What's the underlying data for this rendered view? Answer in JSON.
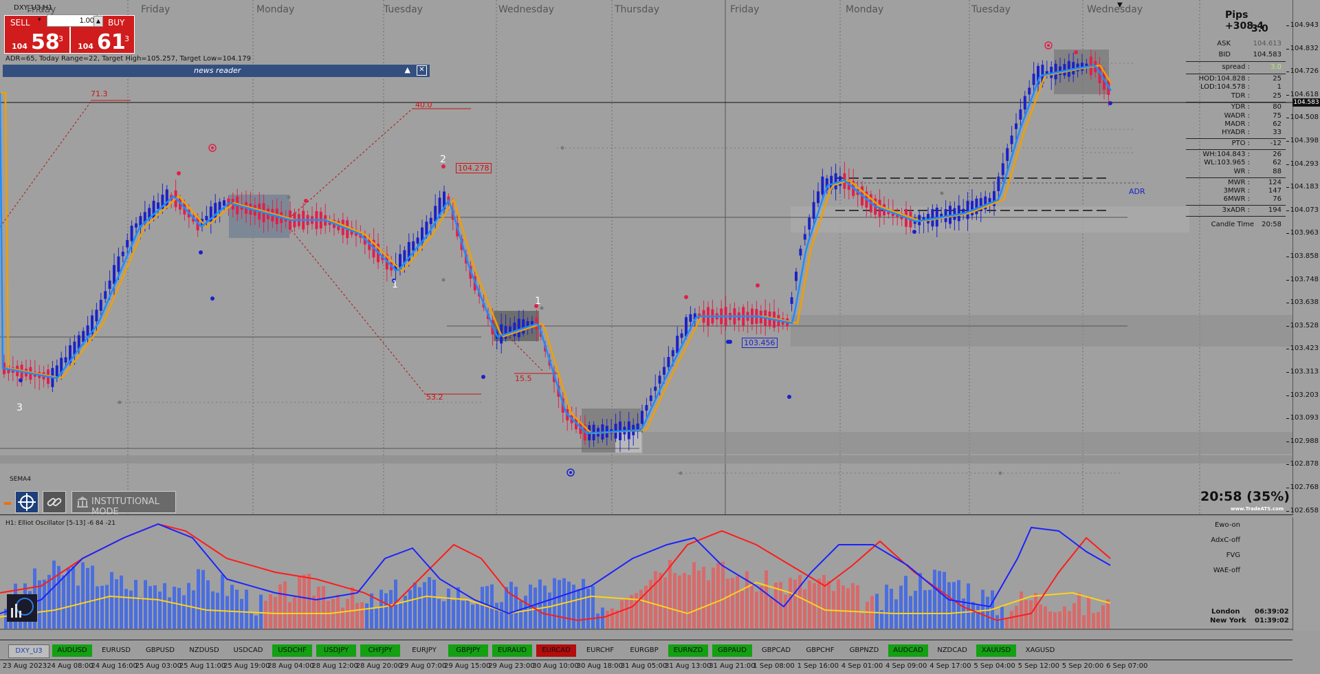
{
  "chart": {
    "symbol_label": "DXY_U3,H1",
    "day_labels": [
      "Friday",
      "Monday",
      "Tuesday",
      "Wednesday",
      "Thursday",
      "Friday",
      "Monday",
      "Tuesday",
      "Wednesday"
    ],
    "adr_line": "ADR=65, Today Range=22, Target High=105.257, Target Low=104.179",
    "news_reader_title": "news reader",
    "indicator_label": "SEMA4",
    "institutional_mode_label": "INSTITUTIONAL MODE",
    "clock_readout": "20:58 (35%)",
    "watermark": "www.TradeATS.com",
    "adr_tag": "ADR",
    "annotations": {
      "fib_713": "71.3",
      "fib_400": "40.0",
      "fib_532": "53.2",
      "fib_155": "15.5",
      "level_104278": "104.278",
      "level_103456": "103.456",
      "wave_3": "3",
      "wave_2": "2",
      "wave_1a": "1",
      "wave_1b": "1"
    },
    "current_price_tag": "104.583"
  },
  "trade": {
    "sell_label": "SELL",
    "buy_label": "BUY",
    "lot_value": "1.00",
    "sell_small": "104",
    "sell_big": "58",
    "sell_sup": "3",
    "buy_small": "104",
    "buy_big": "61",
    "buy_sup": "3"
  },
  "info": {
    "pips": "Pips +308.4",
    "spread_num": "3.0",
    "ask_label": "ASK",
    "ask_value": "104.613",
    "bid_label": "BID",
    "bid_value": "104.583",
    "spread_label": "spread :",
    "spread_value": "3.0",
    "hod_label": "HOD:104.828 :",
    "hod_value": "25",
    "lod_label": "LOD:104.578 :",
    "lod_value": "1",
    "tdr_label": "TDR :",
    "tdr_value": "25",
    "ydr_label": "YDR :",
    "ydr_value": "80",
    "wadr_label": "WADR :",
    "wadr_value": "75",
    "madr_label": "MADR :",
    "madr_value": "62",
    "hyadr_label": "HYADR :",
    "hyadr_value": "33",
    "pto_label": "PTO :",
    "pto_value": "-12",
    "wh_label": "WH:104.843 :",
    "wh_value": "26",
    "wl_label": "WL:103.965 :",
    "wl_value": "62",
    "wr_label": "WR :",
    "wr_value": "88",
    "mwr_label": "MWR :",
    "mwr_value": "124",
    "mwr3_label": "3MWR :",
    "mwr3_value": "147",
    "mwr6_label": "6MWR :",
    "mwr6_value": "76",
    "adr3_label": "3xADR :",
    "adr3_value": "194",
    "candle_label": "Candle Time",
    "candle_value": "20:58"
  },
  "price_scale": [
    "104.943",
    "104.832",
    "104.726",
    "104.618",
    "104.508",
    "104.398",
    "104.293",
    "104.183",
    "104.073",
    "103.963",
    "103.858",
    "103.748",
    "103.638",
    "103.528",
    "103.423",
    "103.313",
    "103.203",
    "103.093",
    "102.988",
    "102.878",
    "102.768",
    "102.658"
  ],
  "oscillator": {
    "title": "H1: Elliot Oscillator [5-13] -6 84 -21",
    "labels": [
      "Ewo-on",
      "AdxC-off",
      "FVG",
      "WAE-off"
    ],
    "london_label": "London",
    "london_time": "06:39:02",
    "newyork_label": "New York",
    "newyork_time": "01:39:02"
  },
  "symbols": [
    {
      "name": "DXY_U3",
      "state": "selected"
    },
    {
      "name": "AUDUSD",
      "state": "green"
    },
    {
      "name": "EURUSD",
      "state": "none"
    },
    {
      "name": "GBPUSD",
      "state": "none"
    },
    {
      "name": "NZDUSD",
      "state": "none"
    },
    {
      "name": "USDCAD",
      "state": "none"
    },
    {
      "name": "USDCHF",
      "state": "green"
    },
    {
      "name": "USDJPY",
      "state": "green"
    },
    {
      "name": "CHFJPY",
      "state": "green"
    },
    {
      "name": "EURJPY",
      "state": "none"
    },
    {
      "name": "GBPJPY",
      "state": "green"
    },
    {
      "name": "EURAUD",
      "state": "green"
    },
    {
      "name": "EURCAD",
      "state": "red"
    },
    {
      "name": "EURCHF",
      "state": "none"
    },
    {
      "name": "EURGBP",
      "state": "none"
    },
    {
      "name": "EURNZD",
      "state": "green"
    },
    {
      "name": "GBPAUD",
      "state": "green"
    },
    {
      "name": "GBPCAD",
      "state": "none"
    },
    {
      "name": "GBPCHF",
      "state": "none"
    },
    {
      "name": "GBPNZD",
      "state": "none"
    },
    {
      "name": "AUDCAD",
      "state": "green"
    },
    {
      "name": "NZDCAD",
      "state": "none"
    },
    {
      "name": "XAUUSD",
      "state": "green"
    },
    {
      "name": "XAGUSD",
      "state": "none"
    }
  ],
  "date_axis": [
    "23 Aug 2023",
    "24 Aug 08:00",
    "24 Aug 16:00",
    "25 Aug 03:00",
    "25 Aug 11:00",
    "25 Aug 19:00",
    "28 Aug 04:00",
    "28 Aug 12:00",
    "28 Aug 20:00",
    "29 Aug 07:00",
    "29 Aug 15:00",
    "29 Aug 23:00",
    "30 Aug 10:00",
    "30 Aug 18:00",
    "31 Aug 05:00",
    "31 Aug 13:00",
    "31 Aug 21:00",
    "1 Sep 08:00",
    "1 Sep 16:00",
    "4 Sep 01:00",
    "4 Sep 09:00",
    "4 Sep 17:00",
    "5 Sep 04:00",
    "5 Sep 12:00",
    "5 Sep 20:00",
    "6 Sep 07:00"
  ],
  "colors": {
    "sell_red": "#d01c1c",
    "bull_candle": "#1a22c8",
    "bear_candle": "#e0204a",
    "ma_blue": "#1a8cff",
    "ma_orange": "#f0a000",
    "osc_red": "#ff1a1a",
    "osc_blue": "#1a22ff",
    "osc_yellow": "#ffd21a",
    "green_badge": "#13a013",
    "red_badge": "#b30d0d"
  }
}
